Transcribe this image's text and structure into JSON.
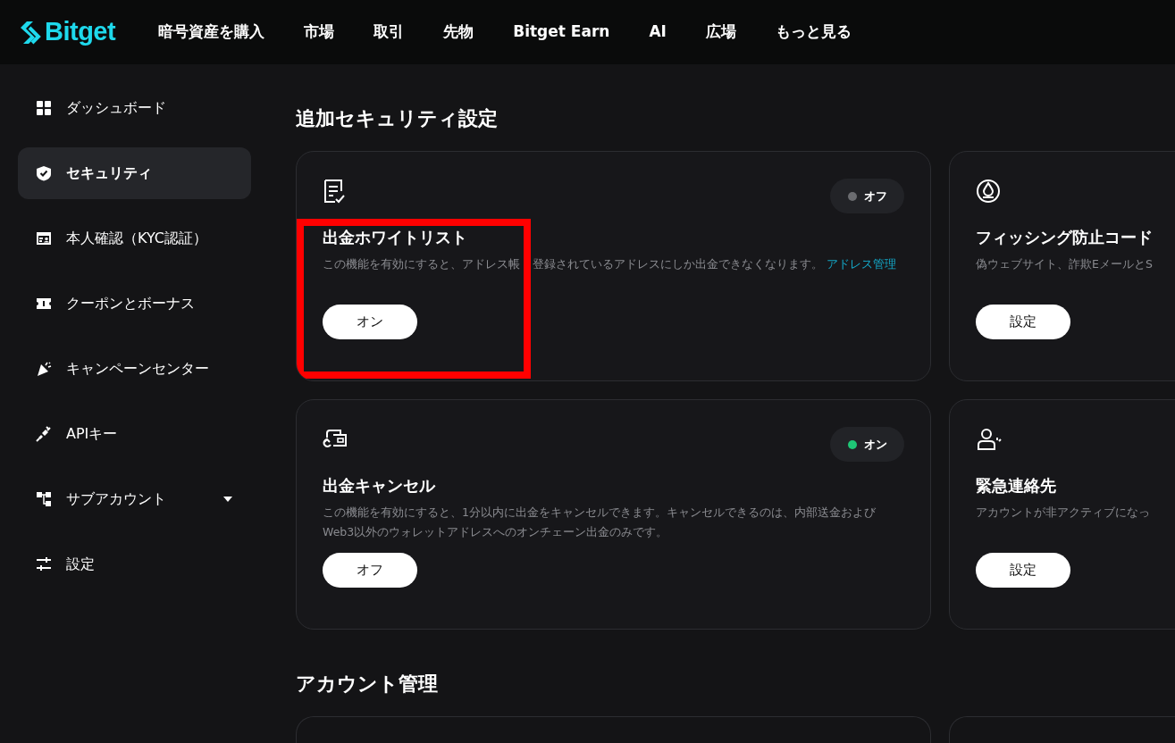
{
  "header": {
    "logo": "Bitget",
    "nav": [
      "暗号資産を購入",
      "市場",
      "取引",
      "先物",
      "Bitget Earn",
      "AI",
      "広場",
      "もっと見る"
    ]
  },
  "sidebar": {
    "items": [
      {
        "label": "ダッシュボード",
        "selected": false
      },
      {
        "label": "セキュリティ",
        "selected": true
      },
      {
        "label": "本人確認（KYC認証）",
        "selected": false
      },
      {
        "label": "クーポンとボーナス",
        "selected": false
      },
      {
        "label": "キャンペーンセンター",
        "selected": false
      },
      {
        "label": "APIキー",
        "selected": false
      },
      {
        "label": "サブアカウント",
        "selected": false,
        "expandable": true
      },
      {
        "label": "設定",
        "selected": false
      }
    ]
  },
  "sections": [
    {
      "title": "追加セキュリティ設定",
      "cards": [
        {
          "title": "出金ホワイトリスト",
          "description": "この機能を有効にすると、アドレス帳",
          "description_continued": "登録されているアドレスにしか出金できなくなります。",
          "link": "アドレス管理",
          "status": {
            "label": "オフ",
            "on": false
          },
          "button": "オン",
          "highlighted": true
        },
        {
          "title": "フィッシング防止コード",
          "description": "偽ウェブサイト、詐欺EメールとS",
          "button": "設定",
          "highlighted": false
        },
        {
          "title": "出金キャンセル",
          "description": "この機能を有効にすると、1分以内に出金をキャンセルできます。キャンセルできるのは、内部送金およびWeb3以外のウォレットアドレスへのオンチェーン出金のみです。",
          "status": {
            "label": "オン",
            "on": true
          },
          "button": "オフ",
          "highlighted": false
        },
        {
          "title": "緊急連絡先",
          "description": "アカウントが非アクティブになっ",
          "button": "設定",
          "highlighted": false
        }
      ]
    },
    {
      "title": "アカウント管理"
    }
  ]
}
